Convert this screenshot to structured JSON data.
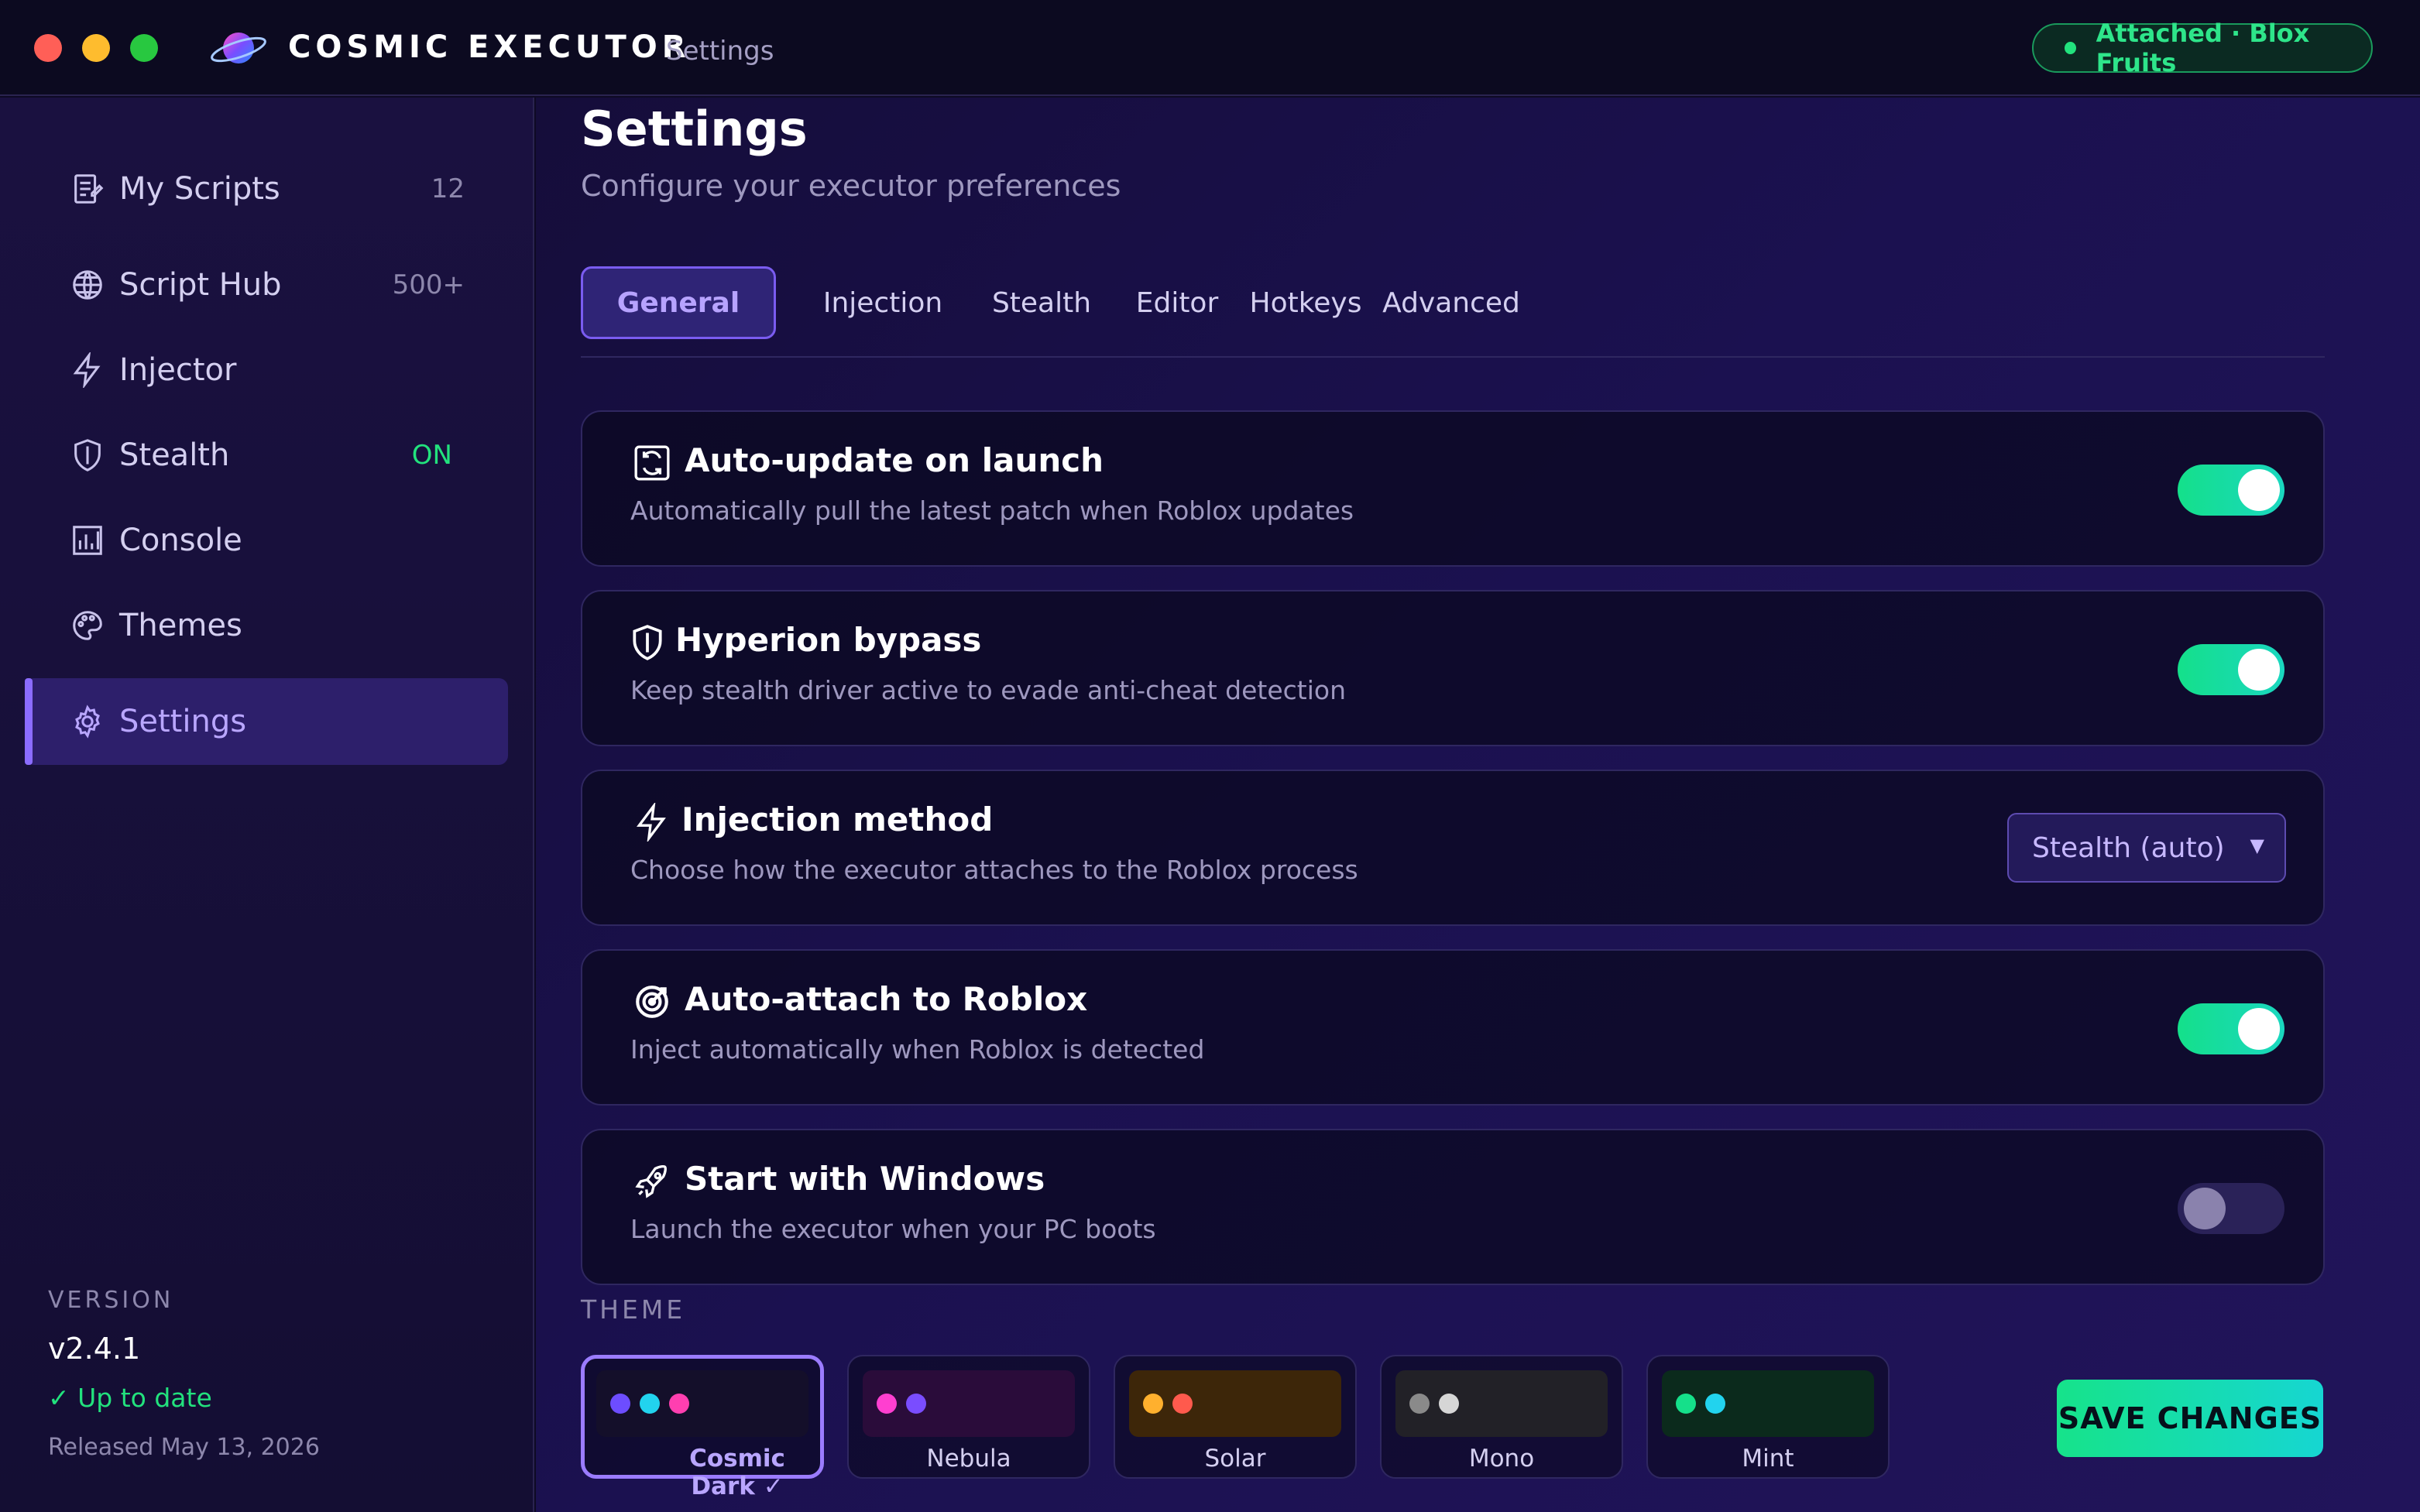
{
  "window": {
    "app_title": "COSMIC EXECUTOR",
    "subtitle": "Settings",
    "status_pill": "Attached · Blox Fruits",
    "status_color": "#22e27d"
  },
  "sidebar": {
    "items": [
      {
        "label": "My Scripts",
        "badge": "12",
        "icon": "document-icon"
      },
      {
        "label": "Script Hub",
        "badge": "500+",
        "icon": "globe-icon"
      },
      {
        "label": "Injector",
        "badge": "",
        "icon": "lightning-icon"
      },
      {
        "label": "Stealth",
        "badge": "ON",
        "icon": "shield-icon"
      },
      {
        "label": "Console",
        "badge": "",
        "icon": "bar-chart-icon"
      },
      {
        "label": "Themes",
        "badge": "",
        "icon": "palette-icon"
      },
      {
        "label": "Settings",
        "badge": "",
        "icon": "gear-icon",
        "active": true
      }
    ],
    "version": {
      "caption": "VERSION",
      "value": "v2.4.1",
      "status": "✓ Up to date",
      "released": "Released May 13, 2026"
    }
  },
  "main": {
    "title": "Settings",
    "subtitle": "Configure your executor preferences",
    "tabs": [
      "General",
      "Injection",
      "Stealth",
      "Editor",
      "Hotkeys",
      "Advanced"
    ],
    "active_tab": "General",
    "settings": [
      {
        "title": "Auto-update on launch",
        "description": "Automatically pull the latest patch when Roblox updates",
        "control": "toggle",
        "enabled": true,
        "icon": "refresh-icon"
      },
      {
        "title": "Hyperion bypass",
        "description": "Keep stealth driver active to evade anti-cheat detection",
        "control": "toggle",
        "enabled": true,
        "icon": "shield-icon"
      },
      {
        "title": "Injection method",
        "description": "Choose how the executor attaches to the Roblox process",
        "control": "select",
        "value": "Stealth (auto)",
        "icon": "lightning-icon"
      },
      {
        "title": "Auto-attach to Roblox",
        "description": "Inject automatically when Roblox is detected",
        "control": "toggle",
        "enabled": true,
        "icon": "target-icon"
      },
      {
        "title": "Start with Windows",
        "description": "Launch the executor when your PC boots",
        "control": "toggle",
        "enabled": false,
        "icon": "rocket-icon"
      }
    ],
    "theme_label": "THEME",
    "themes": [
      {
        "name": "Cosmic Dark",
        "check": "✓",
        "selected": true,
        "bg": "#140f2a",
        "swatches": [
          "#6d4dff",
          "#22d3ee",
          "#ff3fb0"
        ]
      },
      {
        "name": "Nebula",
        "selected": false,
        "bg": "#2a0c3a",
        "swatches": [
          "#ff3fd0",
          "#7a4dff"
        ]
      },
      {
        "name": "Solar",
        "selected": false,
        "bg": "#3d2609",
        "swatches": [
          "#ffb02e",
          "#ff5a4d"
        ]
      },
      {
        "name": "Mono",
        "selected": false,
        "bg": "#222127",
        "swatches": [
          "#8a8a8a",
          "#d6d6d6"
        ]
      },
      {
        "name": "Mint",
        "selected": false,
        "bg": "#0b2a1c",
        "swatches": [
          "#15e08a",
          "#22d3ee"
        ]
      }
    ],
    "save_label": "SAVE CHANGES"
  }
}
